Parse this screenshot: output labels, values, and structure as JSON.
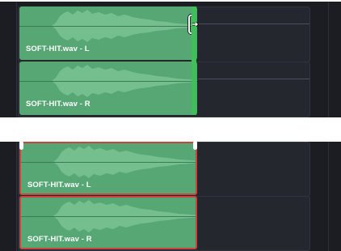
{
  "top_panel": {
    "tracks": [
      {
        "clip_label": "SOFT-HIT.wav - L"
      },
      {
        "clip_label": "SOFT-HIT.wav - R"
      }
    ]
  },
  "bottom_panel": {
    "tracks": [
      {
        "clip_label": "SOFT-HIT.wav - L"
      },
      {
        "clip_label": "SOFT-HIT.wav - R"
      }
    ]
  },
  "colors": {
    "panel_background": "#1b1d22",
    "clip_green": "#56a774",
    "edit_edge_green": "#3fbf57",
    "selection_red": "#c9453f"
  },
  "icons": {
    "trim_cursor": "trim-cursor-icon",
    "clip_handle": "clip-handle-icon"
  }
}
